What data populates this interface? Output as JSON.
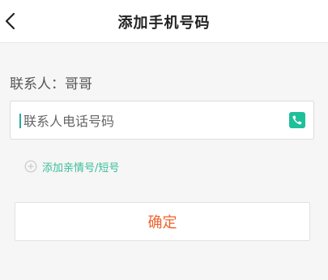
{
  "header": {
    "title": "添加手机号码",
    "back_icon": "chevron-left-icon"
  },
  "contact": {
    "label": "联系人：哥哥"
  },
  "phone_field": {
    "placeholder": "联系人电话号码",
    "value": "",
    "icon": "phone-book-icon",
    "icon_color": "#1fbf9b"
  },
  "add_link": {
    "label": "添加亲情号/短号",
    "icon": "plus-circle-icon",
    "color": "#3bbd9a"
  },
  "confirm_button": {
    "label": "确定",
    "color": "#f0622c"
  }
}
